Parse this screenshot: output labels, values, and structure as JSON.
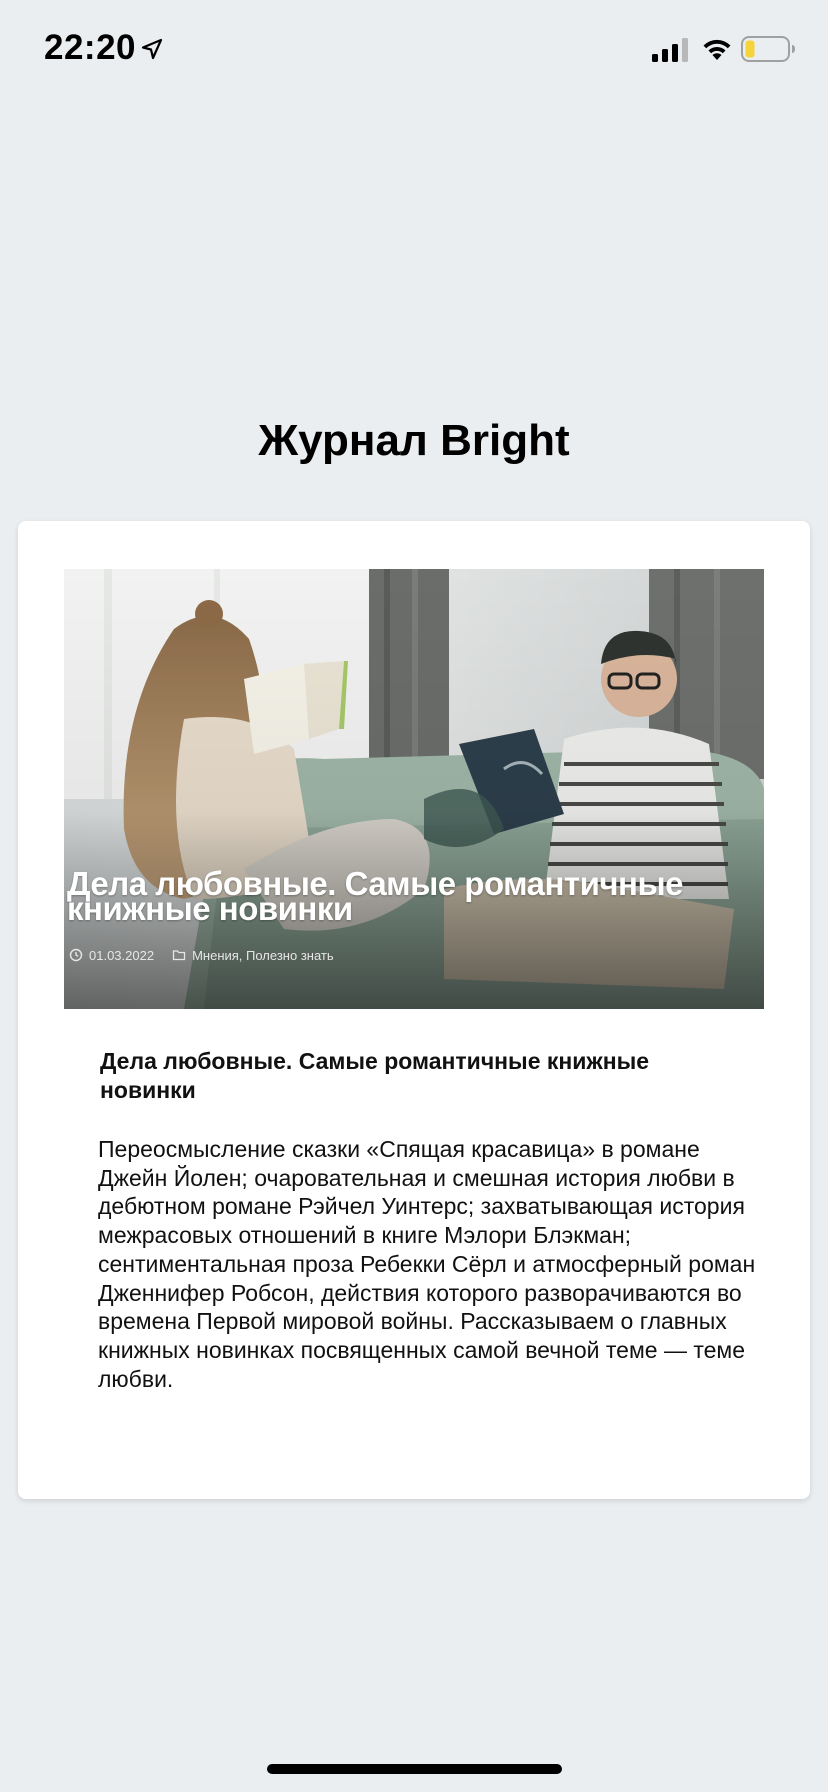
{
  "status_bar": {
    "time": "22:20",
    "icons": [
      "location-arrow-icon",
      "cellular-signal-icon",
      "wifi-icon",
      "battery-low-icon"
    ],
    "battery_color": "#f5d33a"
  },
  "page": {
    "title": "Журнал Bright"
  },
  "article": {
    "hero_title": "Дела любовные. Самые романтичные книжные новинки",
    "date": "01.03.2022",
    "categories": "Мнения, Полезно знать",
    "heading": "Дела любовные. Самые романтичные книжные новинки",
    "excerpt": "Переосмысление сказки «Спящая красавица» в романе Джейн Йолен; очаровательная и смешная история любви в дебютном романе Рэйчел Уинтерс; захватывающая история межрасовых отношений в книге Мэлори Блэкман; сентиментальная проза Ребекки Сёрл и атмосферный роман Дженнифер Робсон, действия которого разворачиваются во времена Первой мировой войны. Рассказываем о главных книжных новинках посвященных самой вечной теме — теме любви."
  },
  "colors": {
    "background": "#ebeef0",
    "card": "#ffffff",
    "text": "#111111"
  }
}
